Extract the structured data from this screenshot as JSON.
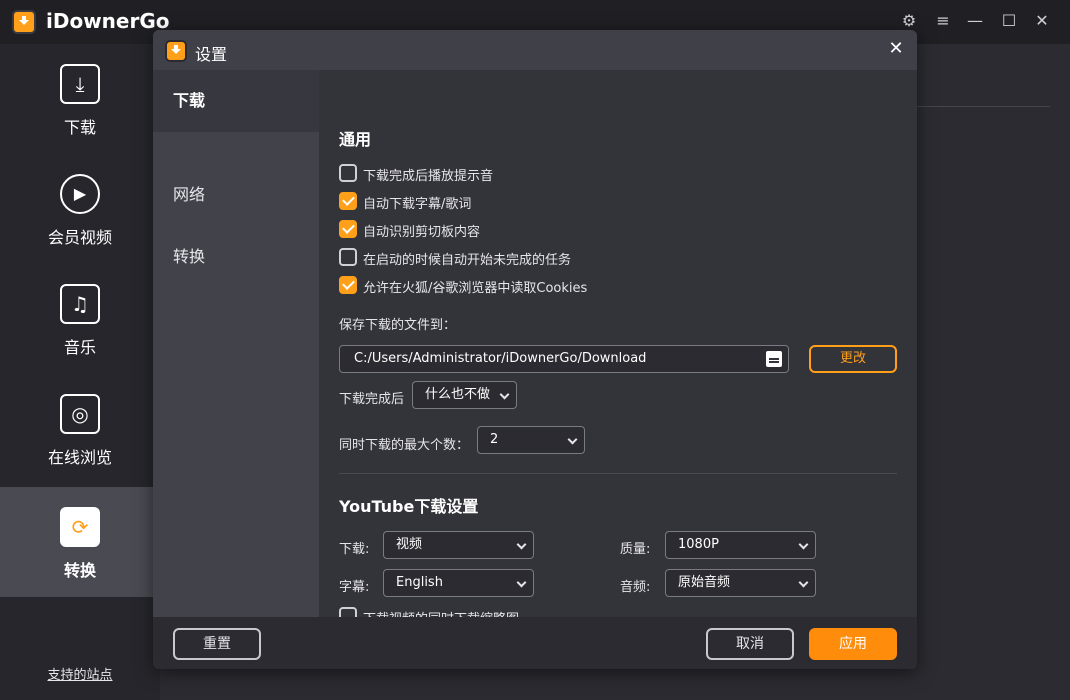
{
  "app": {
    "title": "iDownerGo"
  },
  "window_controls": [
    "gear-icon",
    "menu-icon",
    "minimize-icon",
    "maximize-icon",
    "close-icon"
  ],
  "sidebar": {
    "items": [
      {
        "label": "下载",
        "icon": "download-icon"
      },
      {
        "label": "会员视频",
        "icon": "play-icon"
      },
      {
        "label": "音乐",
        "icon": "music-icon"
      },
      {
        "label": "在线浏览",
        "icon": "globe-icon"
      },
      {
        "label": "转换",
        "icon": "convert-icon",
        "active": true
      }
    ],
    "support_link": "支持的站点"
  },
  "dialog": {
    "title": "设置",
    "tabs": [
      {
        "label": "下载",
        "active": true
      },
      {
        "label": "网络"
      },
      {
        "label": "转换"
      }
    ],
    "general": {
      "title": "通用",
      "options": [
        {
          "label": "下载完成后播放提示音",
          "checked": false
        },
        {
          "label": "自动下载字幕/歌词",
          "checked": true
        },
        {
          "label": "自动识别剪切板内容",
          "checked": true
        },
        {
          "label": "在启动的时候自动开始未完成的任务",
          "checked": false
        },
        {
          "label": "允许在火狐/谷歌浏览器中读取Cookies",
          "checked": true
        }
      ],
      "save_to_label": "保存下载的文件到：",
      "save_path": "C:/Users/Administrator/iDownerGo/Download",
      "change_button": "更改",
      "after_download_label": "下载完成后",
      "after_download_value": "什么也不做",
      "max_downloads_label": "同时下载的最大个数：",
      "max_downloads_value": "2"
    },
    "youtube": {
      "title": "YouTube下载设置",
      "download_label": "下载:",
      "download_value": "视频",
      "quality_label": "质量:",
      "quality_value": "1080P",
      "subtitle_label": "字幕:",
      "subtitle_value": "English",
      "audio_label": "音频:",
      "audio_value": "原始音频",
      "thumbnail_label": "下载视频的同时下载缩略图",
      "thumbnail_checked": false
    },
    "footer": {
      "reset": "重置",
      "cancel": "取消",
      "apply": "应用"
    }
  },
  "colors": {
    "accent": "#ff9f1a",
    "primary_button": "#ff8c0a"
  }
}
